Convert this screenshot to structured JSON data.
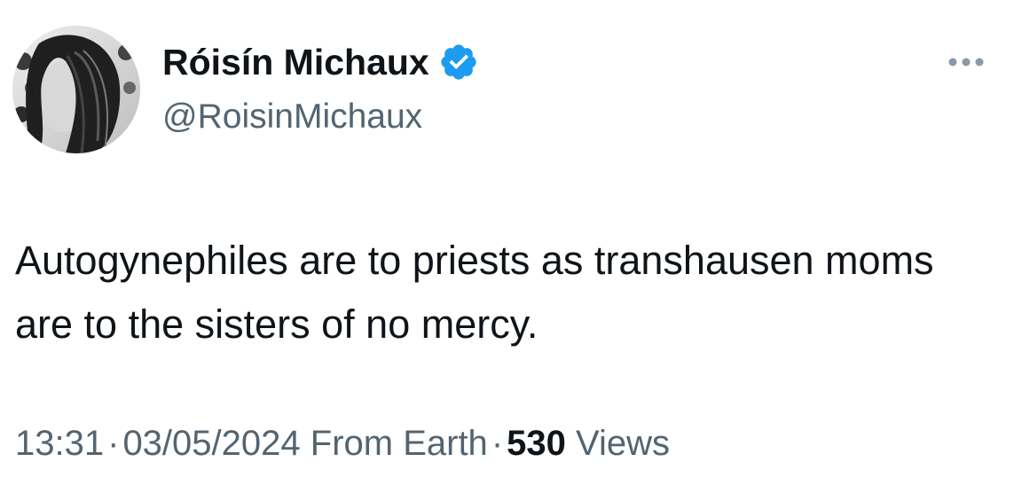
{
  "author": {
    "display_name": "Róisín Michaux",
    "handle": "@RoisinMichaux",
    "verified_icon": "verified-badge-icon",
    "badge_color": "#1d9bf0"
  },
  "tweet": {
    "text": "Autogynephiles are to priests as transhausen moms are to the sisters of no mercy."
  },
  "meta": {
    "time": "13:31",
    "separator": "·",
    "date": "03/05/2024",
    "source": "From Earth",
    "views_count": "530",
    "views_label": "Views"
  },
  "menu": {
    "icon": "more-options-icon"
  }
}
